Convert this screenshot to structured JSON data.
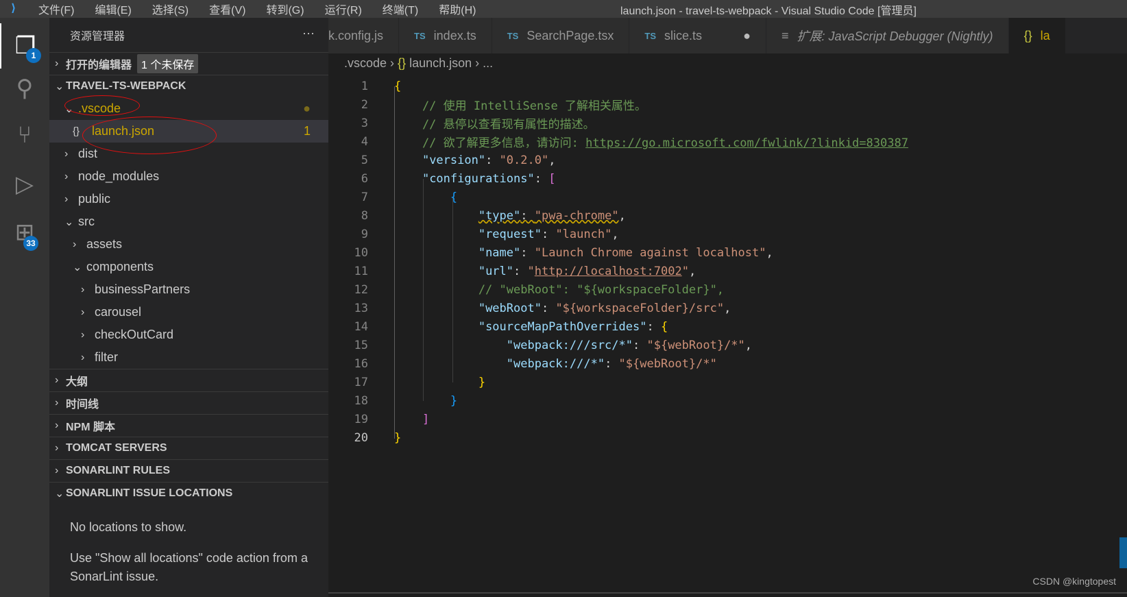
{
  "titlebar": {
    "menu": [
      "文件(F)",
      "编辑(E)",
      "选择(S)",
      "查看(V)",
      "转到(G)",
      "运行(R)",
      "终端(T)",
      "帮助(H)"
    ],
    "title": "launch.json - travel-ts-webpack - Visual Studio Code [管理员]"
  },
  "activity": {
    "explorer_badge": "1",
    "extensions_badge": "33"
  },
  "sidebar": {
    "title": "资源管理器",
    "more": "···",
    "open_editors": "打开的编辑器",
    "unsaved": "1 个未保存",
    "project": "TRAVEL-TS-WEBPACK",
    "tree": [
      {
        "label": ".vscode",
        "open": true,
        "depth": 1
      },
      {
        "label": "launch.json",
        "depth": 2,
        "file": true,
        "badge": "1"
      },
      {
        "label": "dist",
        "depth": 1
      },
      {
        "label": "node_modules",
        "depth": 1
      },
      {
        "label": "public",
        "depth": 1
      },
      {
        "label": "src",
        "open": true,
        "depth": 1
      },
      {
        "label": "assets",
        "depth": 2
      },
      {
        "label": "components",
        "open": true,
        "depth": 2
      },
      {
        "label": "businessPartners",
        "depth": 3
      },
      {
        "label": "carousel",
        "depth": 3
      },
      {
        "label": "checkOutCard",
        "depth": 3
      },
      {
        "label": "filter",
        "depth": 3
      }
    ],
    "sections": [
      "大纲",
      "时间线",
      "NPM 脚本",
      "TOMCAT SERVERS",
      "SONARLINT RULES",
      "SONARLINT ISSUE LOCATIONS"
    ],
    "no_locations": "No locations to show.",
    "hint": "Use \"Show all locations\" code action from a SonarLint issue."
  },
  "tabs": [
    {
      "label": "k.config.js"
    },
    {
      "label": "index.ts",
      "icon": "TS"
    },
    {
      "label": "SearchPage.tsx",
      "icon": "TS"
    },
    {
      "label": "slice.ts",
      "icon": "TS",
      "dirty": "●"
    },
    {
      "label": "扩展: JavaScript Debugger (Nightly)",
      "icon": "≡"
    },
    {
      "label": "la",
      "icon": "{}"
    }
  ],
  "breadcrumb": {
    "folder": ".vscode",
    "file_icon": "{}",
    "file": "launch.json",
    "more": "..."
  },
  "watermark": "CSDN @kingtopest"
}
